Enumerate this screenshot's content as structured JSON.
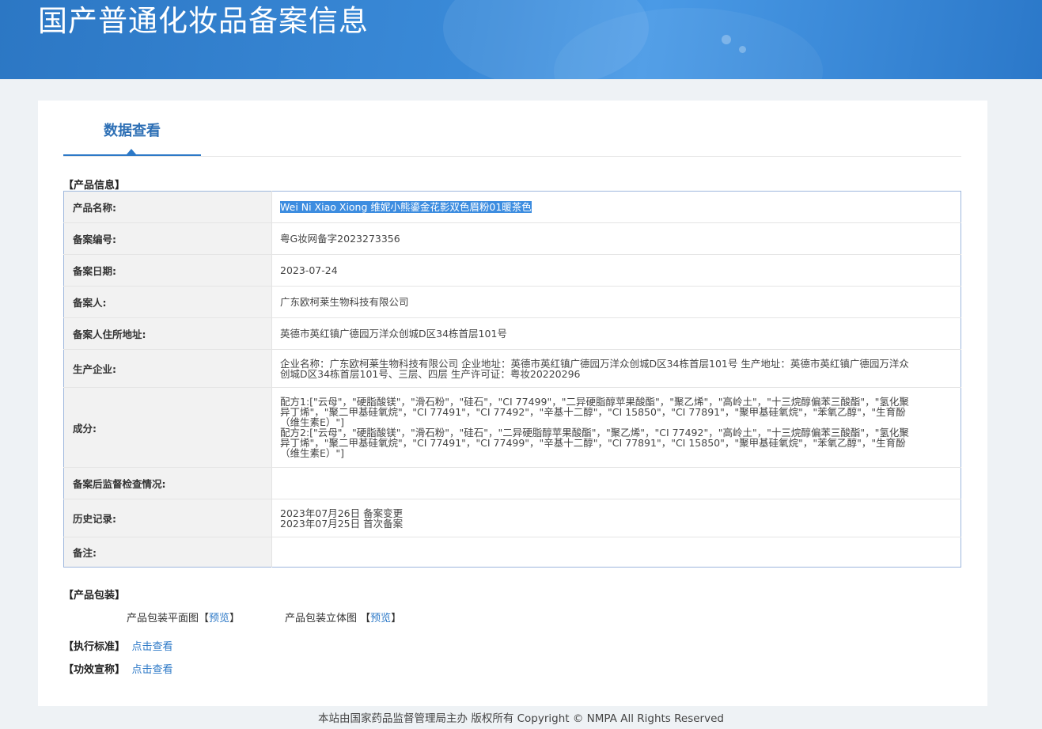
{
  "header": {
    "title": "国产普通化妆品备案信息"
  },
  "tabs": [
    {
      "label": "数据查看"
    }
  ],
  "sections": {
    "product_info": "【产品信息】",
    "packaging": "【产品包装】",
    "standard": "【执行标准】",
    "claims": "【功效宣称】"
  },
  "product_rows": [
    {
      "label": "产品名称:",
      "value": "Wei Ni Xiao Xiong 维妮小熊鎏金花影双色眉粉01暖茶色"
    },
    {
      "label": "备案编号:",
      "value": "粤G妆网备字2023273356"
    },
    {
      "label": "备案日期:",
      "value": "2023-07-24"
    },
    {
      "label": "备案人:",
      "value": "广东欧柯莱生物科技有限公司"
    },
    {
      "label": "备案人住所地址:",
      "value": "英德市英红镇广德园万洋众创城D区34栋首层101号"
    },
    {
      "label": "生产企业:",
      "value": "企业名称：广东欧柯莱生物科技有限公司 企业地址：英德市英红镇广德园万洋众创城D区34栋首层101号 生产地址：英德市英红镇广德园万洋众创城D区34栋首层101号、三层、四层 生产许可证：粤妆20220296"
    },
    {
      "label": "成分:",
      "value_lines": [
        "配方1:[\"云母\"，\"硬脂酸镁\"，\"滑石粉\"，\"硅石\"，\"CI 77499\"，\"二异硬脂醇苹果酸酯\"，\"聚乙烯\"，\"高岭土\"，\"十三烷醇偏苯三酸酯\"，\"氢化聚异丁烯\"，\"聚二甲基硅氧烷\"，\"CI 77491\"，\"CI 77492\"，\"辛基十二醇\"，\"CI 15850\"，\"CI 77891\"，\"聚甲基硅氧烷\"，\"苯氧乙醇\"，\"生育酚（维生素E）\"]",
        "配方2:[\"云母\"，\"硬脂酸镁\"，\"滑石粉\"，\"硅石\"，\"二异硬脂醇苹果酸酯\"，\"聚乙烯\"，\"CI 77492\"，\"高岭土\"，\"十三烷醇偏苯三酸酯\"，\"氢化聚异丁烯\"，\"聚二甲基硅氧烷\"，\"CI 77491\"，\"CI 77499\"，\"辛基十二醇\"，\"CI 77891\"，\"CI 15850\"，\"聚甲基硅氧烷\"，\"苯氧乙醇\"，\"生育酚（维生素E）\"]"
      ]
    },
    {
      "label": "备案后监督检查情况:",
      "value": ""
    },
    {
      "label": "历史记录:",
      "value_lines": [
        "2023年07月26日 备案变更",
        "2023年07月25日 首次备案"
      ]
    },
    {
      "label": "备注:",
      "value": ""
    }
  ],
  "packaging": {
    "flat_label": "产品包装平面图",
    "threed_label": "产品包装立体图",
    "bracket_open": "【",
    "bracket_close": "】",
    "preview_link": "预览"
  },
  "links": {
    "view": "点击查看"
  },
  "footer": {
    "text": "本站由国家药品监督管理局主办 版权所有 Copyright © NMPA All Rights Reserved"
  },
  "colors": {
    "banner": "#3181d0",
    "accent": "#2d79c7",
    "selection": "#3d8de0"
  }
}
